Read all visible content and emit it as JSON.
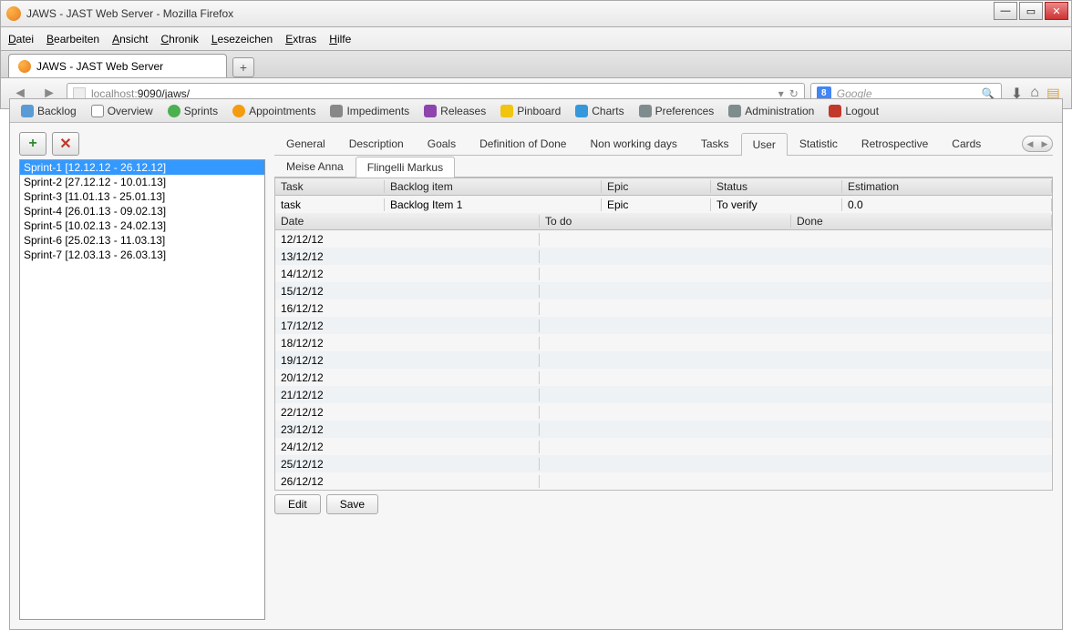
{
  "window": {
    "title": "JAWS - JAST Web Server - Mozilla Firefox"
  },
  "menu": [
    "Datei",
    "Bearbeiten",
    "Ansicht",
    "Chronik",
    "Lesezeichen",
    "Extras",
    "Hilfe"
  ],
  "browser_tab": {
    "title": "JAWS - JAST Web Server"
  },
  "url": {
    "domain": "localhost:",
    "rest": "9090/jaws/"
  },
  "search": {
    "placeholder": "Google"
  },
  "toolbar": [
    {
      "label": "Backlog",
      "icon": "ic-backlog"
    },
    {
      "label": "Overview",
      "icon": "ic-overview"
    },
    {
      "label": "Sprints",
      "icon": "ic-sprints"
    },
    {
      "label": "Appointments",
      "icon": "ic-appt"
    },
    {
      "label": "Impediments",
      "icon": "ic-imped"
    },
    {
      "label": "Releases",
      "icon": "ic-release"
    },
    {
      "label": "Pinboard",
      "icon": "ic-pin"
    },
    {
      "label": "Charts",
      "icon": "ic-charts"
    },
    {
      "label": "Preferences",
      "icon": "ic-pref"
    },
    {
      "label": "Administration",
      "icon": "ic-admin"
    },
    {
      "label": "Logout",
      "icon": "ic-logout"
    }
  ],
  "sprints": [
    "Sprint-1 [12.12.12 - 26.12.12]",
    "Sprint-2 [27.12.12 - 10.01.13]",
    "Sprint-3 [11.01.13 - 25.01.13]",
    "Sprint-4 [26.01.13 - 09.02.13]",
    "Sprint-5 [10.02.13 - 24.02.13]",
    "Sprint-6 [25.02.13 - 11.03.13]",
    "Sprint-7 [12.03.13 - 26.03.13]"
  ],
  "sprint_selected": 0,
  "tabs_main": [
    "General",
    "Description",
    "Goals",
    "Definition of Done",
    "Non working days",
    "Tasks",
    "User",
    "Statistic",
    "Retrospective",
    "Cards"
  ],
  "tabs_main_active": 6,
  "tabs_user": [
    "Meise Anna",
    "Flingelli Markus"
  ],
  "tabs_user_active": 1,
  "task_header": {
    "task": "Task",
    "backlog": "Backlog item",
    "epic": "Epic",
    "status": "Status",
    "est": "Estimation"
  },
  "task_row": {
    "task": "task",
    "backlog": "Backlog Item 1",
    "epic": "Epic",
    "status": "To verify",
    "est": "0.0"
  },
  "date_header": {
    "date": "Date",
    "todo": "To do",
    "done": "Done"
  },
  "dates": [
    "12/12/12",
    "13/12/12",
    "14/12/12",
    "15/12/12",
    "16/12/12",
    "17/12/12",
    "18/12/12",
    "19/12/12",
    "20/12/12",
    "21/12/12",
    "22/12/12",
    "23/12/12",
    "24/12/12",
    "25/12/12",
    "26/12/12"
  ],
  "buttons": {
    "edit": "Edit",
    "save": "Save"
  }
}
